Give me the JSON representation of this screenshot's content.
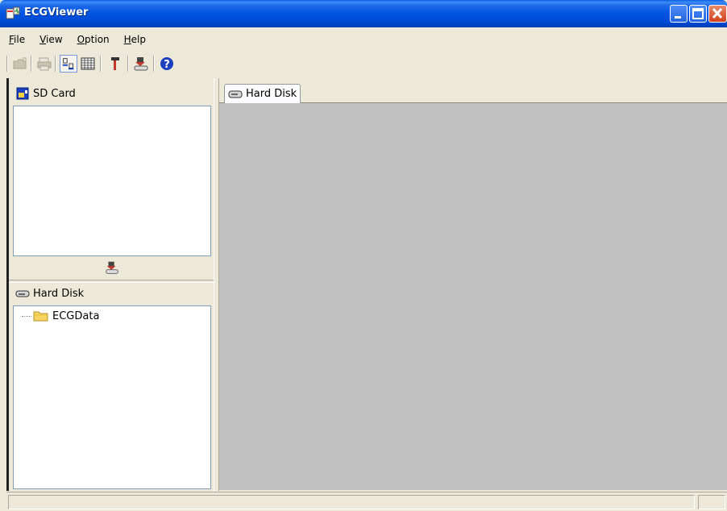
{
  "window": {
    "title": "ECGViewer",
    "icon": "ecg-app-icon"
  },
  "menu": {
    "items": [
      {
        "label": "File",
        "mnemonic": "F",
        "rest": "ile"
      },
      {
        "label": "View",
        "mnemonic": "V",
        "rest": "iew"
      },
      {
        "label": "Option",
        "mnemonic": "O",
        "rest": "ption"
      },
      {
        "label": "Help",
        "mnemonic": "H",
        "rest": "elp"
      }
    ]
  },
  "toolbar": {
    "buttons": [
      {
        "icon": "open-folder-icon",
        "enabled": false
      },
      {
        "icon": "print-icon",
        "enabled": false
      },
      {
        "icon": "list-view-icon",
        "enabled": true,
        "pressed": true
      },
      {
        "icon": "detail-view-icon",
        "enabled": true
      },
      {
        "icon": "hammer-tool-icon",
        "enabled": true
      },
      {
        "icon": "download-to-disk-icon",
        "enabled": true
      },
      {
        "icon": "help-icon",
        "enabled": true
      }
    ]
  },
  "sd_card_pane": {
    "title": "SD Card",
    "icon": "sd-card-icon",
    "action_icon": "download-to-disk-icon"
  },
  "hard_disk_pane": {
    "title": "Hard Disk",
    "icon": "hard-disk-icon",
    "tree": [
      {
        "label": "ECGData",
        "icon": "folder-icon"
      }
    ]
  },
  "right_pane": {
    "tab_label": "Hard Disk",
    "tab_icon": "hard-disk-icon"
  },
  "colors": {
    "titlebar": "#0054e3",
    "content_bg": "#c0c0c0",
    "frame_bg": "#ece9d8"
  }
}
